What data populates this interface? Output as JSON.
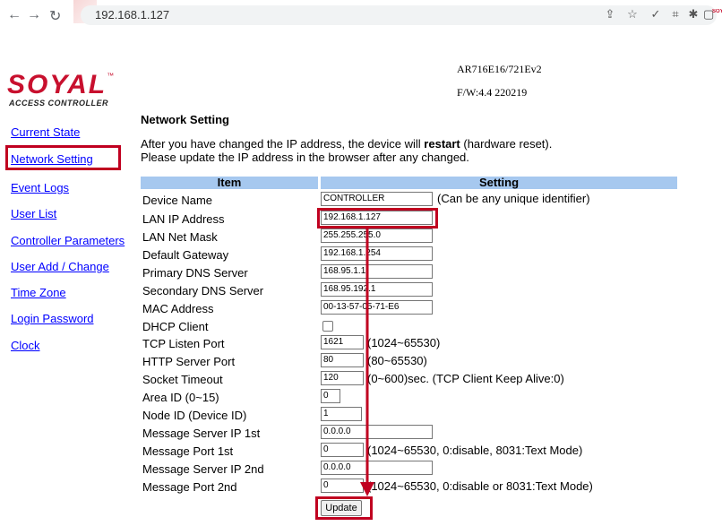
{
  "browser": {
    "url": "192.168.1.127",
    "ext_label": "SOYAL"
  },
  "header": {
    "logo": "SOYAL",
    "logo_tm": "™",
    "logo_sub": "ACCESS CONTROLLER",
    "model": "AR716E16/721Ev2",
    "firmware": "F/W:4.4 220219"
  },
  "sidebar": {
    "items": [
      {
        "label": "Current State"
      },
      {
        "label": "Network Setting"
      },
      {
        "label": "Event Logs"
      },
      {
        "label": "User List"
      },
      {
        "label": "Controller Parameters"
      },
      {
        "label": "User Add / Change"
      },
      {
        "label": "Time Zone"
      },
      {
        "label": "Login Password"
      },
      {
        "label": "Clock"
      }
    ]
  },
  "main": {
    "title": "Network Setting",
    "msg1_pre": "After you have changed the IP address, the device will ",
    "msg1_bold": "restart",
    "msg1_post": " (hardware reset).",
    "msg2": "Please update the IP address in the browser after any changed.",
    "col_item": "Item",
    "col_setting": "Setting",
    "update": "Update"
  },
  "rows": [
    {
      "label": "Device Name",
      "value": "CONTROLLER",
      "note": "(Can be any unique identifier)"
    },
    {
      "label": "LAN IP Address",
      "value": "192.168.1.127",
      "note": ""
    },
    {
      "label": "LAN Net Mask",
      "value": "255.255.255.0",
      "note": ""
    },
    {
      "label": "Default Gateway",
      "value": "192.168.1.254",
      "note": ""
    },
    {
      "label": "Primary DNS Server",
      "value": "168.95.1.1",
      "note": ""
    },
    {
      "label": "Secondary DNS Server",
      "value": "168.95.192.1",
      "note": ""
    },
    {
      "label": "MAC Address",
      "value": "00-13-57-05-71-E6",
      "note": ""
    },
    {
      "label": "DHCP Client",
      "value": "",
      "note": ""
    },
    {
      "label": "TCP Listen Port",
      "value": "1621",
      "note": "(1024~65530)"
    },
    {
      "label": "HTTP Server Port",
      "value": "80",
      "note": "(80~65530)"
    },
    {
      "label": "Socket Timeout",
      "value": "120",
      "note": "(0~600)sec. (TCP Client Keep Alive:0)"
    },
    {
      "label": "Area ID (0~15)",
      "value": "0",
      "note": ""
    },
    {
      "label": "Node ID (Device ID)",
      "value": "1",
      "note": ""
    },
    {
      "label": "Message Server IP 1st",
      "value": "0.0.0.0",
      "note": ""
    },
    {
      "label": "Message Port 1st",
      "value": "0",
      "note": "(1024~65530, 0:disable,  8031:Text Mode)"
    },
    {
      "label": "Message Server IP 2nd",
      "value": "0.0.0.0",
      "note": ""
    },
    {
      "label": "Message Port 2nd",
      "value": "0",
      "note": "(1024~65530, 0:disable or 8031:Text Mode)"
    }
  ],
  "colors": {
    "highlight": "#c00020",
    "header_bg": "#a6c8ef",
    "link": "#0000ff"
  }
}
